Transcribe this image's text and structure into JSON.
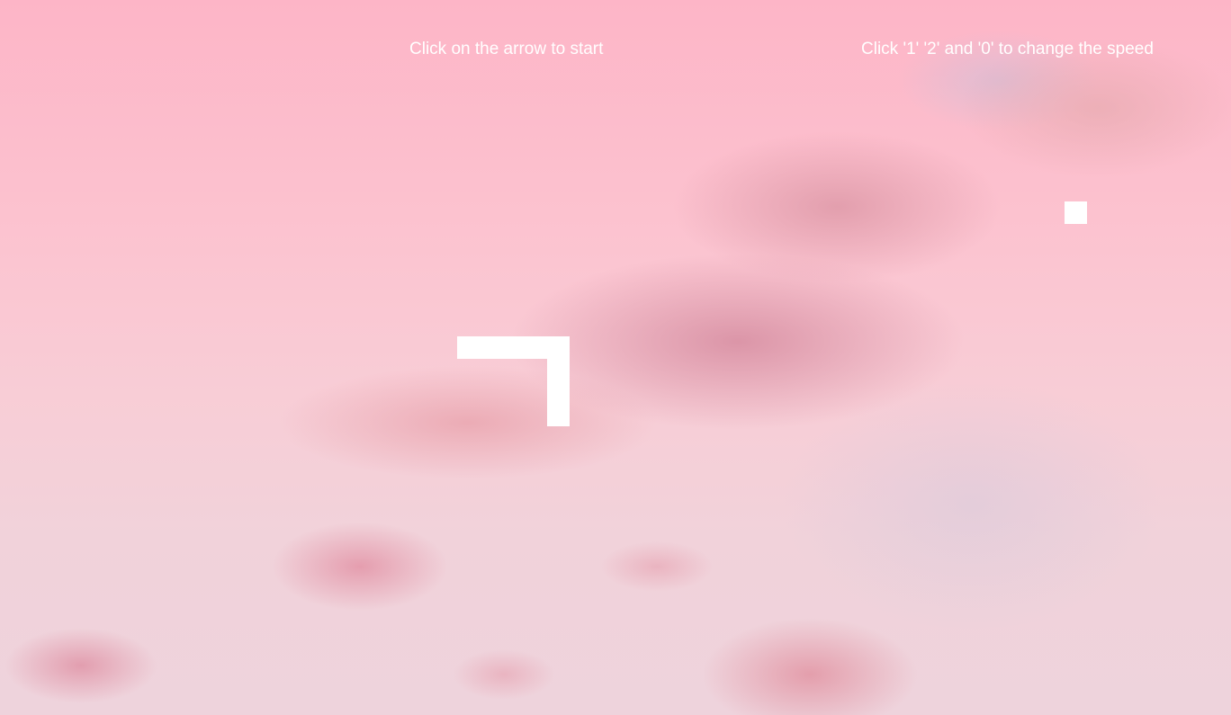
{
  "hints": {
    "start": "Click on the arrow to start",
    "speed": "Click '1' '2' and '0' to change the speed"
  },
  "colors": {
    "snake": "#ffffff",
    "food": "#ffffff",
    "sky_top": "#fdb5c7",
    "sky_bottom": "#eed3dc"
  },
  "snake_length_cells": 9
}
